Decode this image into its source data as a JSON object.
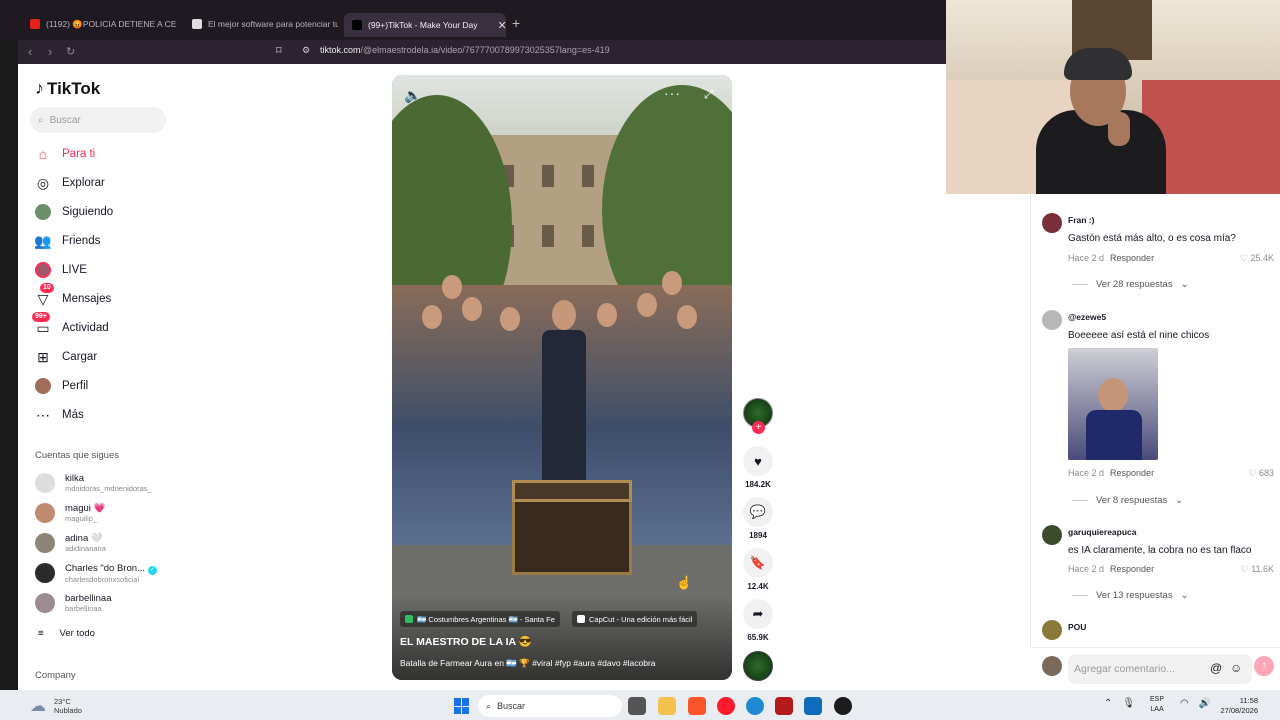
{
  "browser": {
    "tabs": [
      {
        "label": "(1192) 😡POLICIA DETIENE A CEVIC"
      },
      {
        "label": "El mejor software para potenciar tu"
      },
      {
        "label": "(99+)TikTok - Make Your Day",
        "close": "✕"
      }
    ],
    "new_tab": "+",
    "url_host": "tiktok.com",
    "url_path": "/@elmaestrodela.ia/video/7677700789973025357lang=es-419"
  },
  "sidebar": {
    "logo": "TikTok",
    "search_placeholder": "Buscar",
    "nav": [
      {
        "label": "Para ti",
        "icon": "home-icon"
      },
      {
        "label": "Explorar",
        "icon": "compass-icon"
      },
      {
        "label": "Siguiendo",
        "icon": "following-avatar-icon"
      },
      {
        "label": "Friends",
        "icon": "friends-icon"
      },
      {
        "label": "LIVE",
        "icon": "live-icon"
      },
      {
        "label": "Mensajes",
        "icon": "messages-icon",
        "badge": "10"
      },
      {
        "label": "Actividad",
        "icon": "activity-icon",
        "badge": "99+"
      },
      {
        "label": "Cargar",
        "icon": "upload-icon"
      },
      {
        "label": "Perfil",
        "icon": "profile-icon"
      },
      {
        "label": "Más",
        "icon": "more-icon"
      }
    ],
    "following_title": "Cuentas que sigues",
    "accounts": [
      {
        "name": "kilka",
        "handle": "mdnidoras_mdnenidoras_"
      },
      {
        "name": "magui 💗",
        "handle": "maguilip_"
      },
      {
        "name": "adina 🤍",
        "handle": "adidinanana"
      },
      {
        "name": "Charles \"do Bron...",
        "handle": "charlesdobronxsoficial",
        "verified": true
      },
      {
        "name": "barbellinaa",
        "handle": "barbellinaa"
      }
    ],
    "see_all": "Ver todo",
    "company": "Company"
  },
  "video": {
    "chip1": "🇦🇷 Costumbres Argentinas 🇦🇷 - Santa Fe",
    "chip2": "CapCut - Una edición más fácil",
    "title": "EL MAESTRO DE LA IA 😎",
    "description": "Batalla de Farmear Aura en 🇦🇷 🏆 #viral #fyp #aura #davo #lacobra"
  },
  "actions": {
    "likes": "184.2K",
    "comments": "1894",
    "saves": "12.4K",
    "shares": "65.9K"
  },
  "comments": [
    {
      "user": "Fran :)",
      "text": "Gastón está más alto, o es cosa mía?",
      "time": "Hace 2 d",
      "reply": "Responder",
      "likes": "25.4K",
      "replies": "Ver 28 respuestas"
    },
    {
      "user": "@ezewe5",
      "text": "Boeeeee así está el nine chicos",
      "time": "Hace 2 d",
      "reply": "Responder",
      "likes": "683",
      "replies": "Ver 8 respuestas"
    },
    {
      "user": "garuquiereapuca",
      "text": "es IA claramente, la cobra no es tan flaco",
      "time": "Hace 2 d",
      "reply": "Responder",
      "likes": "11.6K",
      "replies": "Ver 13 respuestas"
    },
    {
      "user": "POU"
    }
  ],
  "comment_input_placeholder": "Agregar comentario...",
  "taskbar": {
    "temp": "23°C",
    "weather": "Nublado",
    "search": "Buscar",
    "lang1": "ESP",
    "lang2": "LAA",
    "time": "11:58",
    "date": "27/08/2026"
  }
}
